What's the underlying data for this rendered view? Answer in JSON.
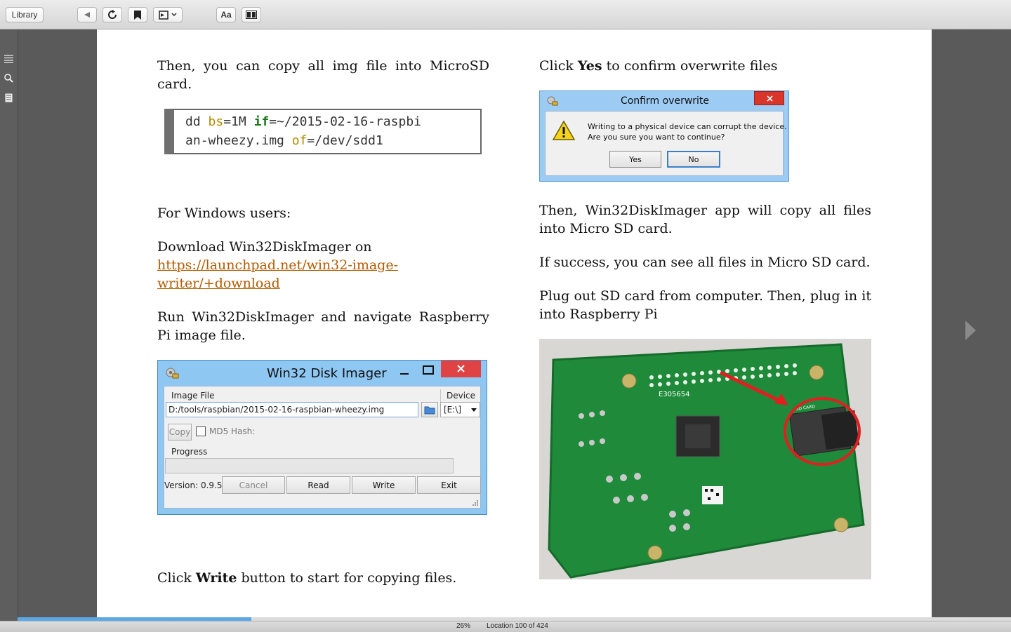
{
  "toolbar": {
    "library_label": "Library",
    "font_label": "Aa"
  },
  "page": {
    "left": {
      "para1": "Then, you can copy all img file into MicroSD card.",
      "code": {
        "line1_a": "dd ",
        "line1_bs": "bs",
        "line1_b": "=1M ",
        "line1_if": "if",
        "line1_c": "=~/2015-02-16-raspbi",
        "line2_a": "an-wheezy.img ",
        "line2_of": "of",
        "line2_b": "=/dev/sdd1"
      },
      "para2": "For Windows users:",
      "para3": "Download Win32DiskImager on",
      "link": "https://launchpad.net/win32-image-writer/+download",
      "para4": "Run Win32DiskImager and navigate Raspberry Pi image file.",
      "para5_bold": "Write",
      "para5_pre": "Click ",
      "para5_post": " button to start for copying files."
    },
    "right": {
      "para1_pre": "Click ",
      "para1_bold": "Yes",
      "para1_post": " to confirm overwrite files",
      "para2": "Then, Win32DiskImager app will copy all files into Micro SD card.",
      "para3": "If success, you can see all files in Micro SD card.",
      "para4": "Plug out SD card from computer. Then, plug in it into Raspberry Pi"
    }
  },
  "imager": {
    "title": "Win32 Disk Imager",
    "image_file_label": "Image File",
    "device_label": "Device",
    "path": "D:/tools/raspbian/2015-02-16-raspbian-wheezy.img",
    "device": "[E:\\]",
    "copy_label": "Copy",
    "md5_label": "MD5 Hash:",
    "progress_label": "Progress",
    "version": "Version: 0.9.5",
    "cancel": "Cancel",
    "read": "Read",
    "write": "Write",
    "exit": "Exit"
  },
  "confirm": {
    "title": "Confirm overwrite",
    "line1": "Writing to a physical device can corrupt the device.",
    "line2": "Are you sure you want to continue?",
    "yes": "Yes",
    "no": "No"
  },
  "photo": {
    "board_marking": "E305654",
    "card_label": "SD CARD"
  },
  "status": {
    "percent": "26%",
    "location": "Location 100 of 424",
    "progress_fraction": 0.235
  },
  "colors": {
    "accent": "#5aa9e6",
    "link": "#b35a00",
    "board_green": "#1f8a3a",
    "highlight_red": "#e02020"
  }
}
